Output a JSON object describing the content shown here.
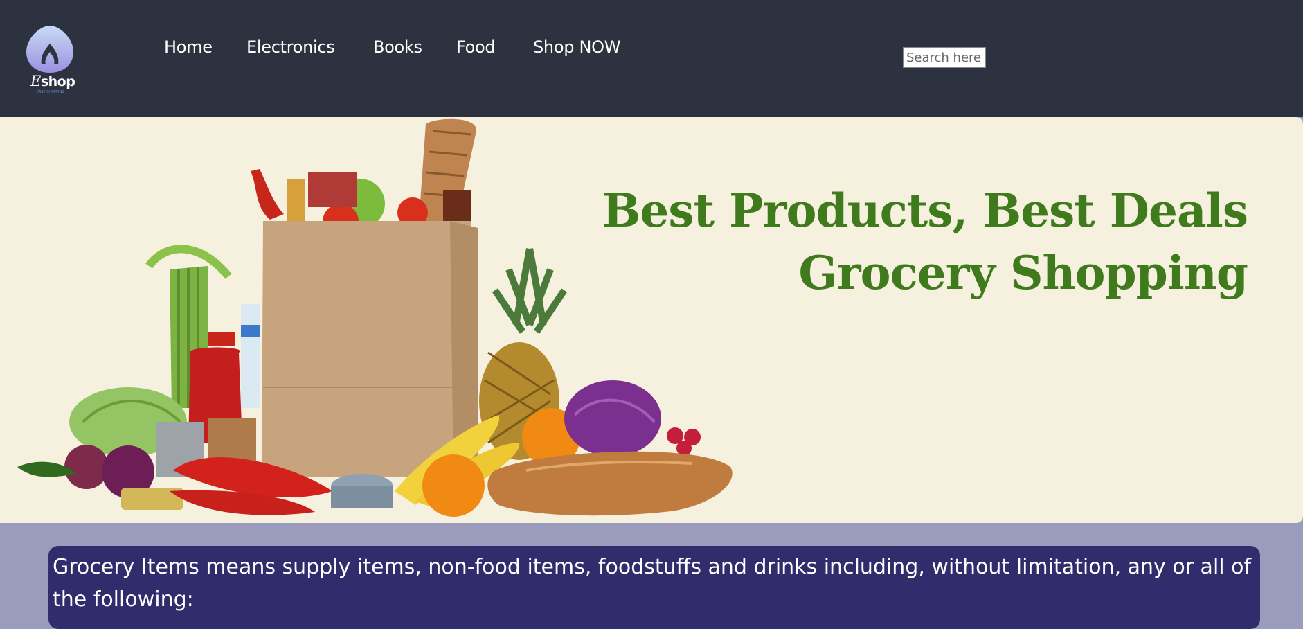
{
  "header": {
    "logo": {
      "brand": "Eshop",
      "brand_initial": "E",
      "brand_rest": "shop",
      "tagline": "EASY SHOPPING"
    },
    "nav": [
      {
        "label": "Home"
      },
      {
        "label": "Electronics"
      },
      {
        "label": "Books"
      },
      {
        "label": "Food"
      },
      {
        "label": "Shop NOW"
      }
    ],
    "search": {
      "placeholder": "Search here..",
      "value": ""
    }
  },
  "banner": {
    "headline_line1": "Best Products, Best Deals",
    "headline_line2": "Grocery Shopping"
  },
  "content": {
    "intro": "Grocery Items means supply items, non-food items, foodstuffs and drinks including, without limitation, any or all of the following:"
  },
  "colors": {
    "header_bg": "#2d3240",
    "banner_bg": "#f6f1de",
    "headline": "#3f7a1d",
    "page_bg": "#9b9bbd",
    "card_bg": "#312c6b"
  }
}
